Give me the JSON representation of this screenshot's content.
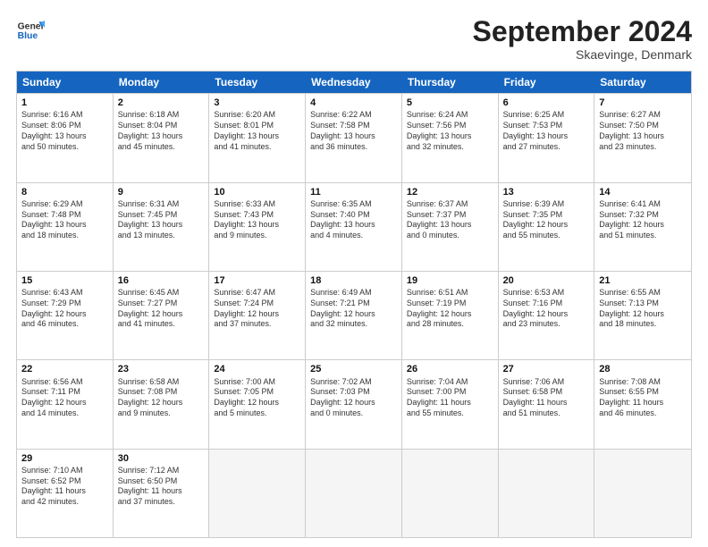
{
  "header": {
    "logo_line1": "General",
    "logo_line2": "Blue",
    "month": "September 2024",
    "location": "Skaevinge, Denmark"
  },
  "days_of_week": [
    "Sunday",
    "Monday",
    "Tuesday",
    "Wednesday",
    "Thursday",
    "Friday",
    "Saturday"
  ],
  "weeks": [
    [
      {
        "day": "1",
        "info": "Sunrise: 6:16 AM\nSunset: 8:06 PM\nDaylight: 13 hours\nand 50 minutes."
      },
      {
        "day": "2",
        "info": "Sunrise: 6:18 AM\nSunset: 8:04 PM\nDaylight: 13 hours\nand 45 minutes."
      },
      {
        "day": "3",
        "info": "Sunrise: 6:20 AM\nSunset: 8:01 PM\nDaylight: 13 hours\nand 41 minutes."
      },
      {
        "day": "4",
        "info": "Sunrise: 6:22 AM\nSunset: 7:58 PM\nDaylight: 13 hours\nand 36 minutes."
      },
      {
        "day": "5",
        "info": "Sunrise: 6:24 AM\nSunset: 7:56 PM\nDaylight: 13 hours\nand 32 minutes."
      },
      {
        "day": "6",
        "info": "Sunrise: 6:25 AM\nSunset: 7:53 PM\nDaylight: 13 hours\nand 27 minutes."
      },
      {
        "day": "7",
        "info": "Sunrise: 6:27 AM\nSunset: 7:50 PM\nDaylight: 13 hours\nand 23 minutes."
      }
    ],
    [
      {
        "day": "8",
        "info": "Sunrise: 6:29 AM\nSunset: 7:48 PM\nDaylight: 13 hours\nand 18 minutes."
      },
      {
        "day": "9",
        "info": "Sunrise: 6:31 AM\nSunset: 7:45 PM\nDaylight: 13 hours\nand 13 minutes."
      },
      {
        "day": "10",
        "info": "Sunrise: 6:33 AM\nSunset: 7:43 PM\nDaylight: 13 hours\nand 9 minutes."
      },
      {
        "day": "11",
        "info": "Sunrise: 6:35 AM\nSunset: 7:40 PM\nDaylight: 13 hours\nand 4 minutes."
      },
      {
        "day": "12",
        "info": "Sunrise: 6:37 AM\nSunset: 7:37 PM\nDaylight: 13 hours\nand 0 minutes."
      },
      {
        "day": "13",
        "info": "Sunrise: 6:39 AM\nSunset: 7:35 PM\nDaylight: 12 hours\nand 55 minutes."
      },
      {
        "day": "14",
        "info": "Sunrise: 6:41 AM\nSunset: 7:32 PM\nDaylight: 12 hours\nand 51 minutes."
      }
    ],
    [
      {
        "day": "15",
        "info": "Sunrise: 6:43 AM\nSunset: 7:29 PM\nDaylight: 12 hours\nand 46 minutes."
      },
      {
        "day": "16",
        "info": "Sunrise: 6:45 AM\nSunset: 7:27 PM\nDaylight: 12 hours\nand 41 minutes."
      },
      {
        "day": "17",
        "info": "Sunrise: 6:47 AM\nSunset: 7:24 PM\nDaylight: 12 hours\nand 37 minutes."
      },
      {
        "day": "18",
        "info": "Sunrise: 6:49 AM\nSunset: 7:21 PM\nDaylight: 12 hours\nand 32 minutes."
      },
      {
        "day": "19",
        "info": "Sunrise: 6:51 AM\nSunset: 7:19 PM\nDaylight: 12 hours\nand 28 minutes."
      },
      {
        "day": "20",
        "info": "Sunrise: 6:53 AM\nSunset: 7:16 PM\nDaylight: 12 hours\nand 23 minutes."
      },
      {
        "day": "21",
        "info": "Sunrise: 6:55 AM\nSunset: 7:13 PM\nDaylight: 12 hours\nand 18 minutes."
      }
    ],
    [
      {
        "day": "22",
        "info": "Sunrise: 6:56 AM\nSunset: 7:11 PM\nDaylight: 12 hours\nand 14 minutes."
      },
      {
        "day": "23",
        "info": "Sunrise: 6:58 AM\nSunset: 7:08 PM\nDaylight: 12 hours\nand 9 minutes."
      },
      {
        "day": "24",
        "info": "Sunrise: 7:00 AM\nSunset: 7:05 PM\nDaylight: 12 hours\nand 5 minutes."
      },
      {
        "day": "25",
        "info": "Sunrise: 7:02 AM\nSunset: 7:03 PM\nDaylight: 12 hours\nand 0 minutes."
      },
      {
        "day": "26",
        "info": "Sunrise: 7:04 AM\nSunset: 7:00 PM\nDaylight: 11 hours\nand 55 minutes."
      },
      {
        "day": "27",
        "info": "Sunrise: 7:06 AM\nSunset: 6:58 PM\nDaylight: 11 hours\nand 51 minutes."
      },
      {
        "day": "28",
        "info": "Sunrise: 7:08 AM\nSunset: 6:55 PM\nDaylight: 11 hours\nand 46 minutes."
      }
    ],
    [
      {
        "day": "29",
        "info": "Sunrise: 7:10 AM\nSunset: 6:52 PM\nDaylight: 11 hours\nand 42 minutes."
      },
      {
        "day": "30",
        "info": "Sunrise: 7:12 AM\nSunset: 6:50 PM\nDaylight: 11 hours\nand 37 minutes."
      },
      {
        "day": "",
        "info": ""
      },
      {
        "day": "",
        "info": ""
      },
      {
        "day": "",
        "info": ""
      },
      {
        "day": "",
        "info": ""
      },
      {
        "day": "",
        "info": ""
      }
    ]
  ]
}
